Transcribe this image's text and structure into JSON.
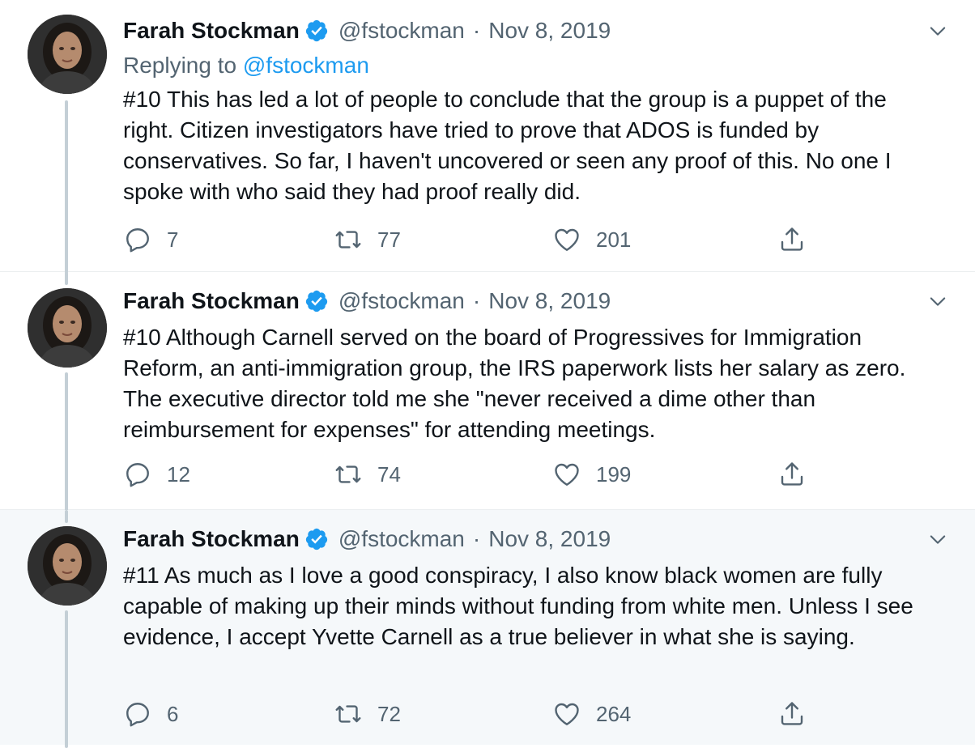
{
  "tweets": [
    {
      "author": "Farah Stockman",
      "handle": "@fstockman",
      "separator": "·",
      "date": "Nov 8, 2019",
      "replying_prefix": "Replying to",
      "replying_to": "@fstockman",
      "text": "#10 This has led a lot of people to conclude that the group is a puppet of the right. Citizen investigators have tried to prove that ADOS is funded by conservatives. So far, I haven't uncovered or seen any proof of this. No one I spoke with who said they had proof really did.",
      "replies": "7",
      "retweets": "77",
      "likes": "201"
    },
    {
      "author": "Farah Stockman",
      "handle": "@fstockman",
      "separator": "·",
      "date": "Nov 8, 2019",
      "text": "#10 Although Carnell served on the board of Progressives for Immigration Reform, an anti-immigration group, the IRS paperwork lists her salary as zero. The executive director told me she \"never received a dime other than reimbursement for expenses\" for attending meetings.",
      "replies": "12",
      "retweets": "74",
      "likes": "199"
    },
    {
      "author": "Farah Stockman",
      "handle": "@fstockman",
      "separator": "·",
      "date": "Nov 8, 2019",
      "text": "#11 As much as I love a good conspiracy, I also know black women are fully capable of making up their minds without funding from white men. Unless I see evidence, I accept Yvette Carnell as a true believer in what she is saying.",
      "replies": "6",
      "retweets": "72",
      "likes": "264"
    }
  ],
  "icons": {
    "verified": "verified-badge-icon",
    "caret": "chevron-down-icon",
    "reply": "reply-icon",
    "retweet": "retweet-icon",
    "like": "heart-icon",
    "share": "share-icon"
  },
  "colors": {
    "accent": "#1d9bf0",
    "text": "#0f1419",
    "muted": "#536471",
    "thread_line": "#c4cfd6",
    "highlight_bg": "#f5f8fa"
  }
}
